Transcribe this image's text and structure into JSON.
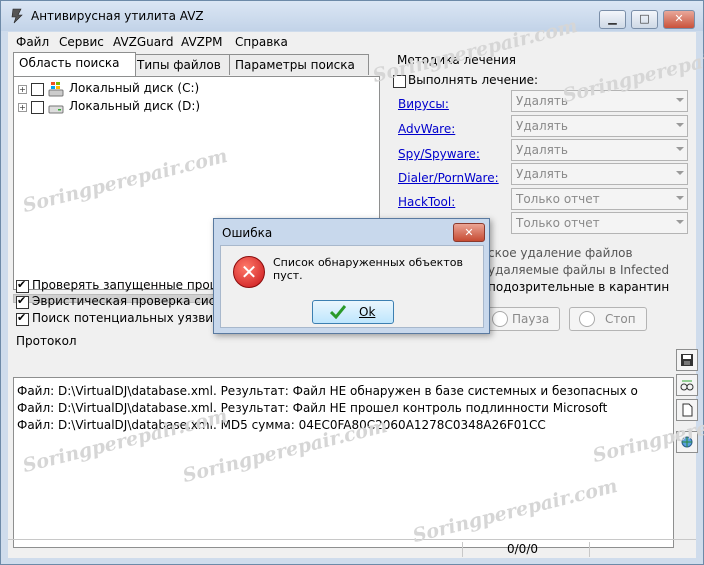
{
  "window": {
    "title": "Антивирусная утилита AVZ",
    "controls": {
      "minimize": "▁",
      "maximize": "□",
      "close": "✕"
    }
  },
  "menu": [
    "Файл",
    "Сервис",
    "AVZGuard",
    "AVZPM",
    "Справка"
  ],
  "tabs": [
    "Область поиска",
    "Типы файлов",
    "Параметры поиска"
  ],
  "tree": [
    {
      "label": "Локальный диск (C:)",
      "icon": "windows-drive-icon"
    },
    {
      "label": "Локальный диск (D:)",
      "icon": "drive-icon"
    }
  ],
  "checks": [
    {
      "label": "Проверять запущенные процессы",
      "checked": true
    },
    {
      "label": "Эвристическая проверка системы",
      "checked": true
    },
    {
      "label": "Поиск потенциальных уязвимостей",
      "checked": true
    }
  ],
  "treatment": {
    "title": "Методика лечения",
    "perform_label": "Выполнять лечение:",
    "perform_checked": false,
    "rows": [
      {
        "label": "Вирусы:",
        "value": "Удалять"
      },
      {
        "label": "AdvWare:",
        "value": "Удалять"
      },
      {
        "label": "Spy/Spyware:",
        "value": "Удалять"
      },
      {
        "label": "Dialer/PornWare:",
        "value": "Удалять"
      },
      {
        "label": "HackTool:",
        "value": "Только отчет"
      },
      {
        "label": "",
        "value": "Только отчет"
      }
    ],
    "extra_lines": [
      "ское удаление файлов",
      "удаляемые файлы в  Infected",
      "подозрительные в  карантин"
    ]
  },
  "buttons": {
    "pause": "Пауза",
    "stop": "Стоп"
  },
  "protocol": {
    "label": "Протокол",
    "lines": [
      "Файл: D:\\VirtualDJ\\database.xml. Результат: Файл НЕ обнаружен в базе системных и безопасных о",
      "Файл: D:\\VirtualDJ\\database.xml. Результат: Файл НЕ прошел контроль подлинности Microsoft",
      "Файл: D:\\VirtualDJ\\database.xml. MD5 сумма: 04EC0FA80C2060A1278C0348A26F01CC"
    ]
  },
  "status": {
    "counter": "0/0/0"
  },
  "dialog": {
    "title": "Ошибка",
    "message": "Список обнаруженных объектов пуст.",
    "ok_label": "Ok",
    "close": "✕"
  },
  "watermark": "Soringperepair.com"
}
